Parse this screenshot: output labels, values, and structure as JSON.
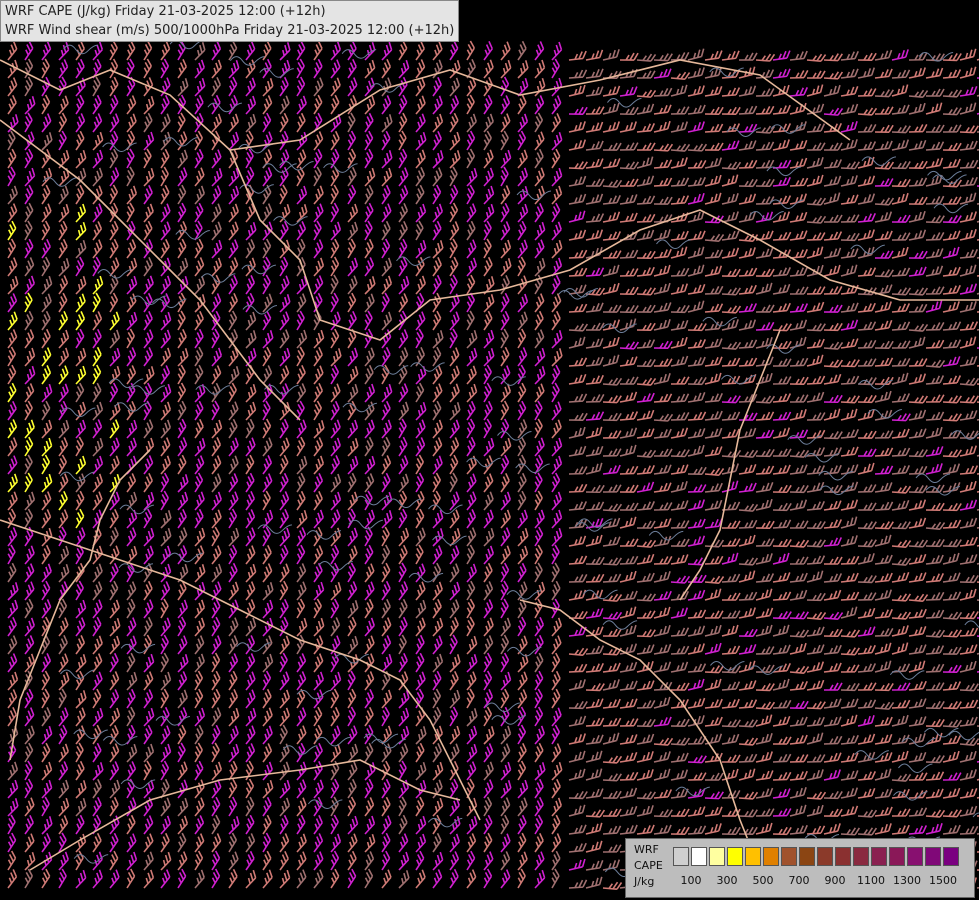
{
  "title": {
    "line1": "WRF CAPE (J/kg) Friday 21-03-2025 12:00 (+12h)",
    "line2": "WRF Wind shear (m/s) 500/1000hPa Friday 21-03-2025 12:00 (+12h)"
  },
  "legend": {
    "label_line1": "WRF",
    "label_line2": "CAPE",
    "label_line3": "J/kg",
    "colors": [
      "#cfcfcf",
      "#ffffff",
      "#ffffa0",
      "#ffff00",
      "#ffc000",
      "#e08000",
      "#a0522d",
      "#8b4513",
      "#8b3a2a",
      "#8a3030",
      "#8a2a40",
      "#8a2050",
      "#8a1858",
      "#881070",
      "#800878",
      "#7a0080"
    ],
    "ticks": [
      "100",
      "300",
      "500",
      "700",
      "900",
      "1100",
      "1300",
      "1500"
    ]
  },
  "map": {
    "background": "#000000",
    "border_color": "#e6b89a",
    "contour_color": "#6c7e9a",
    "barb_colors": [
      "#a07070",
      "#d07a75",
      "#e89080",
      "#d020d0",
      "#b030c0",
      "#ffff30"
    ]
  }
}
